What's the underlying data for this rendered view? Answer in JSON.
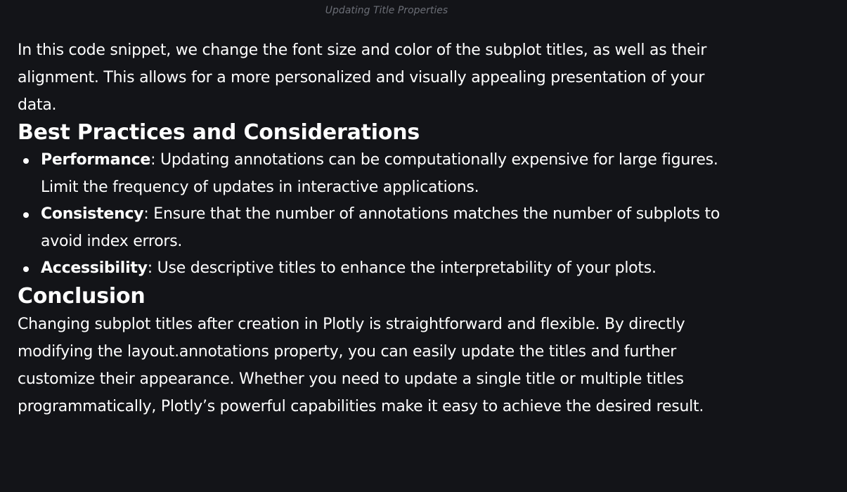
{
  "caption": "Updating Title Properties",
  "intro_paragraph": "In this code snippet, we change the font size and color of the subplot titles, as well as their alignment. This allows for a more personalized and visually appealing presentation of your data.",
  "best_practices": {
    "heading": "Best Practices and Considerations",
    "items": [
      {
        "term": "Performance",
        "text": ": Updating annotations can be computationally expensive for large figures. Limit the frequency of updates in interactive applications."
      },
      {
        "term": "Consistency",
        "text": ": Ensure that the number of annotations matches the number of subplots to avoid index errors."
      },
      {
        "term": "Accessibility",
        "text": ": Use descriptive titles to enhance the interpretability of your plots."
      }
    ]
  },
  "conclusion": {
    "heading": "Conclusion",
    "paragraph": "Changing subplot titles after creation in Plotly is straightforward and flexible. By directly modifying the layout.annotations property, you can easily update the titles and further customize their appearance. Whether you need to update a single title or multiple titles programmatically, Plotly’s powerful capabilities make it easy to achieve the desired result."
  }
}
